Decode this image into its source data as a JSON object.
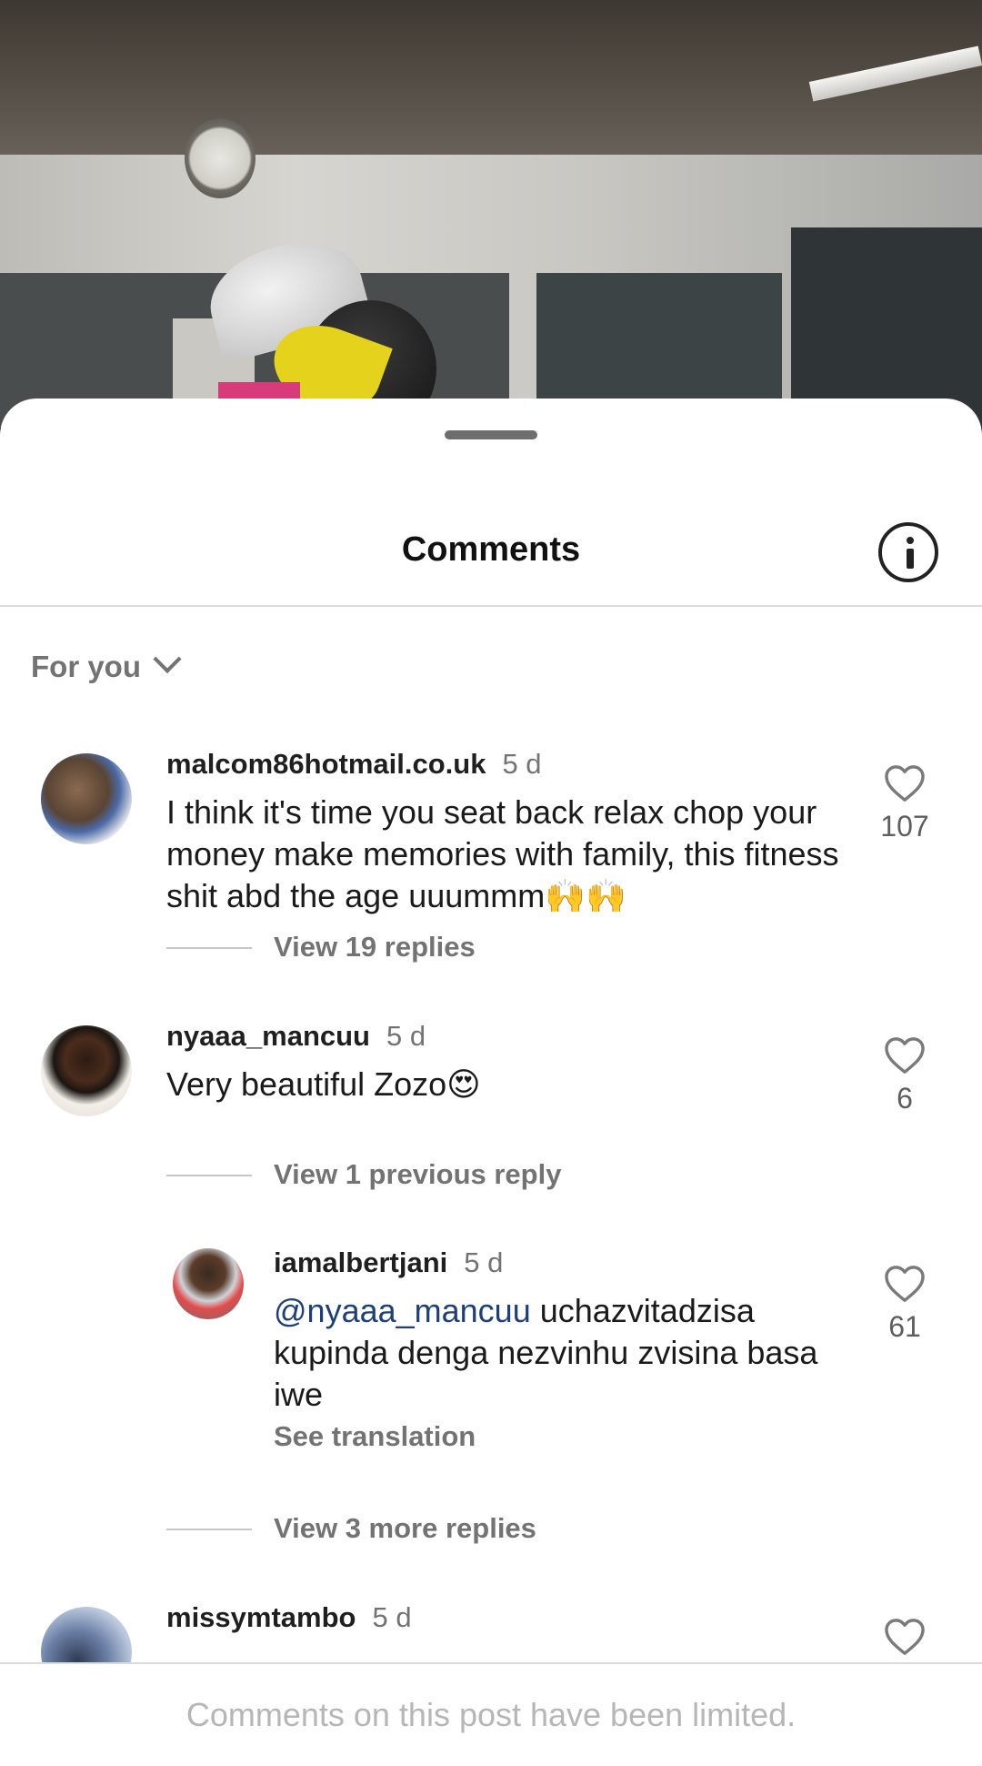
{
  "sheet": {
    "title": "Comments",
    "filter_label": "For you"
  },
  "comments": [
    {
      "username": "malcom86hotmail.co.uk",
      "time": "5 d",
      "text": "I think it's time you seat back relax chop your money make memories with family, this fitness shit abd the age uuummm🙌🙌",
      "likes": "107",
      "replies_link": "View 19 replies"
    },
    {
      "username": "nyaaa_mancuu",
      "time": "5 d",
      "text": "Very beautiful  Zozo😍",
      "likes": "6",
      "previous_link": "View 1 previous reply",
      "reply": {
        "username": "iamalbertjani",
        "time": "5 d",
        "mention": "@nyaaa_mancuu",
        "text": " uchazvitadzisa kupinda denga nezvinhu zvisina basa iwe",
        "likes": "61",
        "translate_link": "See translation"
      },
      "more_link": "View 3 more replies"
    },
    {
      "username": "missymtambo",
      "time": "5 d"
    }
  ],
  "footer": {
    "limited_text": "Comments on this post have been limited."
  },
  "colors": {
    "accent_mention": "#1d3f7a",
    "muted": "#737373"
  },
  "icons": {
    "info": "info-icon",
    "like": "heart-icon",
    "filter": "chevron-down-icon"
  }
}
